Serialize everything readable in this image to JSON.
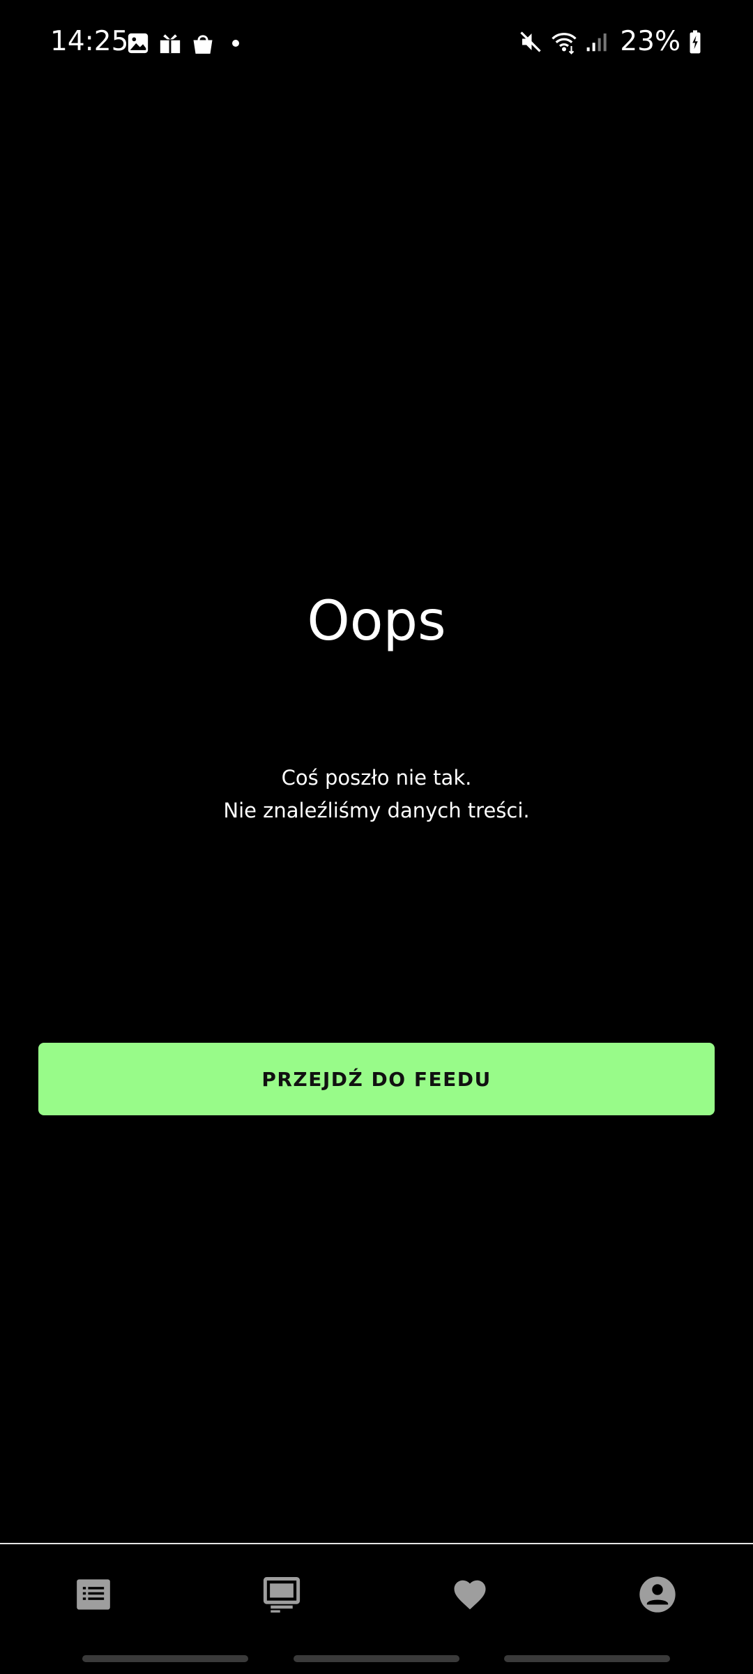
{
  "status_bar": {
    "time": "14:25",
    "battery_text": "23%",
    "left_icons": [
      "image-icon",
      "gift-icon",
      "shopping-bag-icon",
      "notification-dot"
    ],
    "right_icons": [
      "muted-icon",
      "wifi-icon",
      "signal-icon",
      "battery-charging-icon"
    ]
  },
  "error": {
    "title": "Oops",
    "line1": "Coś poszło nie tak.",
    "line2": "Nie znaleźliśmy danych treści."
  },
  "actions": {
    "go_to_feed_label": "PRZEJDŹ DO FEEDU"
  },
  "bottom_nav": {
    "items": [
      {
        "icon": "list-icon"
      },
      {
        "icon": "tv-icon"
      },
      {
        "icon": "heart-icon"
      },
      {
        "icon": "profile-icon"
      }
    ]
  },
  "colors": {
    "background": "#000000",
    "accent": "#98fb89",
    "text": "#ffffff",
    "nav_icon": "#9e9e9e"
  }
}
